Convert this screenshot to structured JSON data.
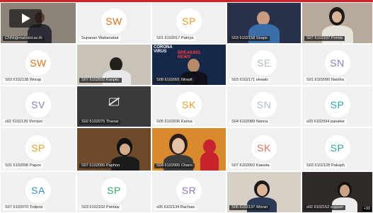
{
  "colors": {
    "accent": "#d61f26"
  },
  "overflow_label": "+33",
  "tiles": [
    {
      "name": "CNNI@mahidol.ac.th",
      "initials": "",
      "color": "",
      "video": true
    },
    {
      "name": "Supanan Wattanabut",
      "initials": "SW",
      "color": "#d7721f",
      "video": false
    },
    {
      "name": "S01 6102017 Patriya",
      "initials": "SP",
      "color": "#e39d2a",
      "video": false
    },
    {
      "name": "S03 6102158 Sirapo",
      "initials": "",
      "color": "",
      "video": true
    },
    {
      "name": "S07 6102107 Pornte",
      "initials": "",
      "color": "",
      "video": true
    },
    {
      "name": "S03 6102138 Worap",
      "initials": "SW",
      "color": "#d7721f",
      "video": false
    },
    {
      "name": "S07 6102032 Kanpitc",
      "initials": "",
      "color": "",
      "video": true
    },
    {
      "name": "S08 6102091 Niravit",
      "initials": "",
      "color": "",
      "video": true
    },
    {
      "name": "S03 6102171 ekwatc",
      "initials": "SE",
      "color": "#b3bac4",
      "video": false
    },
    {
      "name": "S01 6102090 Nantha",
      "initials": "SN",
      "color": "#8c7ab8",
      "video": false
    },
    {
      "name": "s02 6102139 Vorravo",
      "initials": "SV",
      "color": "#8c7ab8",
      "video": false
    },
    {
      "name": "S02 6102075 Thanat",
      "initials": "",
      "color": "",
      "video": false
    },
    {
      "name": "S05 6102036 Karisa",
      "initials": "SK",
      "color": "#e39d2a",
      "video": false
    },
    {
      "name": "S04 6102089 Nanna",
      "initials": "SN",
      "color": "#b3bac4",
      "video": false
    },
    {
      "name": "s03 6102094 panalee",
      "initials": "SP",
      "color": "#2ea3a8",
      "video": false
    },
    {
      "name": "S01 6102096 Papon",
      "initials": "SP",
      "color": "#e39d2a",
      "video": false
    },
    {
      "name": "S07 6102095 Paphon",
      "initials": "",
      "color": "",
      "video": true
    },
    {
      "name": "S04 6102005 Chano",
      "initials": "",
      "color": "",
      "video": true
    },
    {
      "name": "S07 6102002 Kaewta",
      "initials": "SK",
      "color": "#e0705a",
      "video": false
    },
    {
      "name": "S03 6102128 Pakaph",
      "initials": "SP",
      "color": "#2ea3a8",
      "video": false
    },
    {
      "name": "S07 6102070 Traipop",
      "initials": "SA",
      "color": "#3a8fc9",
      "video": false
    },
    {
      "name": "S03 6102102 Pantaw",
      "initials": "SP",
      "color": "#3aa86b",
      "video": false
    },
    {
      "name": "s05 6102134 Rachaw",
      "initials": "SR",
      "color": "#8c7ab8",
      "video": false
    },
    {
      "name": "S06 6102137 Woran",
      "initials": "",
      "color": "",
      "video": true
    },
    {
      "name": "s02 6102152 suppan",
      "initials": "",
      "color": "",
      "video": true
    }
  ],
  "news_overlay": {
    "line1": "CORONA",
    "line2": "VIRUS",
    "badge1": "BREAKING",
    "badge2": "NEWS"
  }
}
